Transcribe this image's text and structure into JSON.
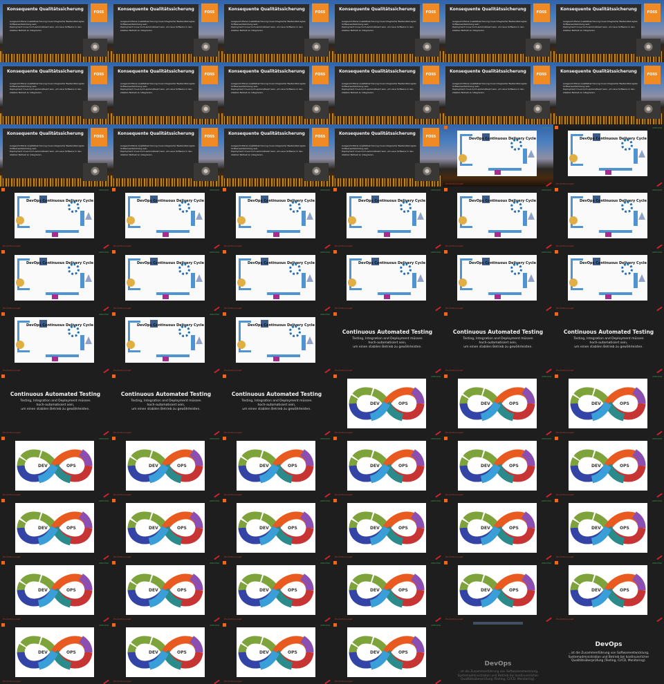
{
  "sheet": {
    "columns": 6,
    "rows": 11
  },
  "slides": {
    "qualitaet": {
      "title": "Konsequente Qualitätssicherung",
      "bullets": [
        "Ausgeschrittene Qualitätssicherung muss integrierter Bestandteil agiler Softwareentwicklung sein.",
        "Deployment muss hoch-automatisiert sein, um neue Software in den stabilen Betrieb zu integrieren."
      ],
      "logo": "FOSS",
      "tag": "AMV.OSU"
    },
    "cycle": {
      "title": "DevOps Continuous Delivery Cycle",
      "tag": "AMV.OSU",
      "footer": "Proof-Of-Concept"
    },
    "testing": {
      "title": "Continuous Automated Testing",
      "line1": "Testing, Integration and Deployment müssen",
      "line2": "hoch-automatisiert sein,",
      "line3": "um einen stabilen Betrieb zu gewährleisten.",
      "footer": "Proof-Of-Concept"
    },
    "infinity": {
      "left_label": "DEV",
      "right_label": "OPS",
      "tag": "AMV.OSU",
      "footer": "Proof-Of-Concept"
    },
    "devops": {
      "title": "DevOps",
      "line1": "...ist die Zusammenführung von Softwareentwicklung,",
      "line2": "Systemadministration und Betrieb bei kontinuierlicher",
      "line3": "Qualitätsüberprüfung (Testing, CI/CD, Monitoring)."
    }
  },
  "colors": {
    "accent_orange": "#e86a1d",
    "cycle_blue": "#4f93d1",
    "brand_red": "#c2272d"
  },
  "icons": [
    "foss-logo-icon",
    "speaker-video-icon",
    "devops-ring-icon",
    "people-icon",
    "kubernetes-icon",
    "triangle-icon"
  ],
  "sequence": [
    "Q",
    "Q",
    "Q",
    "Q",
    "Q",
    "Q",
    "Q",
    "Q",
    "Q",
    "Q",
    "Q",
    "Q",
    "Q",
    "Q",
    "Q",
    "Q",
    "CQ",
    "C",
    "C",
    "C",
    "C",
    "C",
    "C",
    "C",
    "C",
    "C",
    "C",
    "C",
    "C",
    "C",
    "C",
    "C",
    "C",
    "T",
    "T",
    "T",
    "T",
    "T",
    "T",
    "I",
    "I",
    "I",
    "I",
    "I",
    "I",
    "I",
    "I",
    "I",
    "I",
    "I",
    "I",
    "I",
    "I",
    "I",
    "I",
    "I",
    "I",
    "I",
    "I",
    "I",
    "I",
    "I",
    "I",
    "I",
    "E",
    "F"
  ]
}
